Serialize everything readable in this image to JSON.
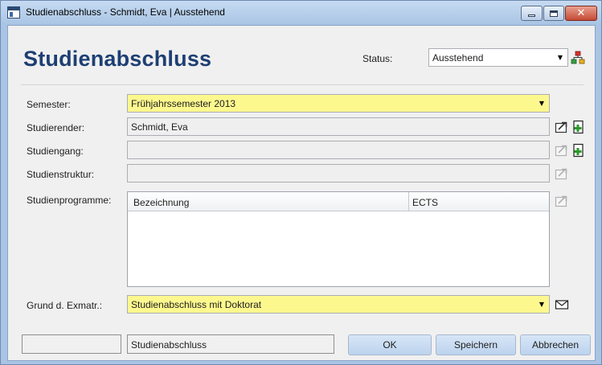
{
  "window": {
    "title": "Studienabschluss - Schmidt, Eva | Ausstehend",
    "minimize_icon": "minimize-icon",
    "maximize_icon": "maximize-icon",
    "close_icon": "close-icon",
    "close_glyph": "✕"
  },
  "header": {
    "title": "Studienabschluss",
    "status_label": "Status:",
    "status_value": "Ausstehend",
    "workflow_icon": "hierarchy-icon"
  },
  "form": {
    "semester_label": "Semester:",
    "semester_value": "Frühjahrssemester 2013",
    "student_label": "Studierender:",
    "student_value": "Schmidt, Eva",
    "program_label": "Studiengang:",
    "program_value": "",
    "structure_label": "Studienstruktur:",
    "structure_value": "",
    "programmes_label": "Studienprogramme:",
    "programmes_columns": [
      "Bezeichnung",
      "ECTS"
    ],
    "programmes_rows": [],
    "reason_label": "Grund d. Exmatr.:",
    "reason_value": "Studienabschluss mit Doktorat",
    "dropdown_arrow": "▼"
  },
  "footer": {
    "left_box_value": "",
    "record_type": "Studienabschluss",
    "ok_label": "OK",
    "save_label": "Speichern",
    "cancel_label": "Abbrechen"
  },
  "colors": {
    "required_field": "#fdf88e",
    "heading": "#1d3f73",
    "readonly_field": "#efefef",
    "button": "#c9dcf2"
  }
}
